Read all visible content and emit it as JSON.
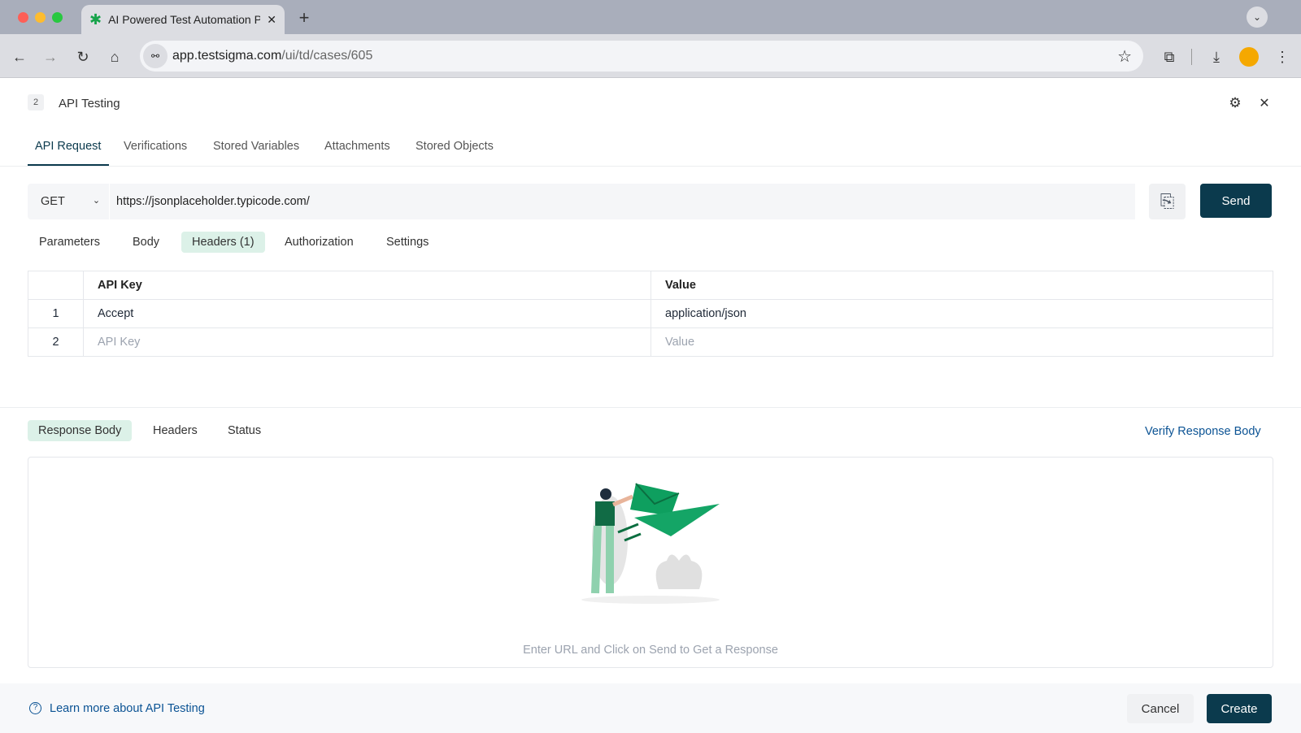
{
  "browser": {
    "tab_title": "AI Powered Test Automation P",
    "url_host": "app.testsigma.com",
    "url_path": "/ui/td/cases/605"
  },
  "header": {
    "step_number": "2",
    "title": "API Testing"
  },
  "tabs": [
    "API Request",
    "Verifications",
    "Stored Variables",
    "Attachments",
    "Stored Objects"
  ],
  "request": {
    "method": "GET",
    "url": "https://jsonplaceholder.typicode.com/",
    "send_label": "Send"
  },
  "sub_tabs": [
    "Parameters",
    "Body",
    "Headers (1)",
    "Authorization",
    "Settings"
  ],
  "headers_table": {
    "columns": [
      "API Key",
      "Value"
    ],
    "rows": [
      {
        "index": "1",
        "key": "Accept",
        "value": "application/json"
      },
      {
        "index": "2",
        "key_placeholder": "API Key",
        "value_placeholder": "Value"
      }
    ]
  },
  "response": {
    "tabs": [
      "Response Body",
      "Headers",
      "Status"
    ],
    "verify_link": "Verify Response Body",
    "empty_message": "Enter URL and Click on Send to Get a Response"
  },
  "footer": {
    "learn_more": "Learn more about API Testing",
    "cancel": "Cancel",
    "create": "Create"
  },
  "colors": {
    "primary": "#0b3a4d",
    "accent_green": "#0f9d58",
    "pill_bg": "#dcf1e8",
    "link": "#0b5394"
  }
}
